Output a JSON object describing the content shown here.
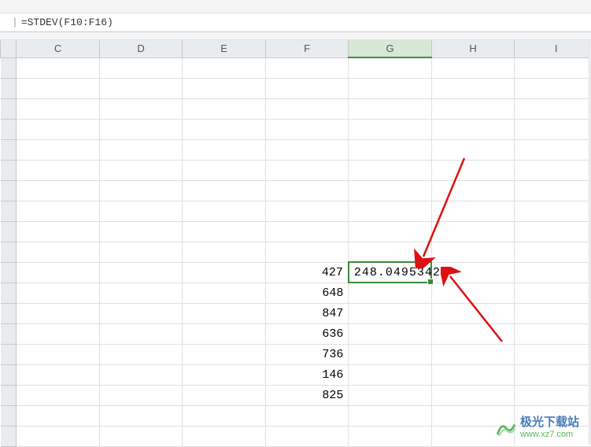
{
  "formula_bar": {
    "formula": "=STDEV(F10:F16)"
  },
  "columns": [
    "C",
    "D",
    "E",
    "F",
    "G",
    "H",
    "I"
  ],
  "active_column": "G",
  "selected_cell": {
    "col": "G",
    "value": "248.0495342"
  },
  "data_column_f": [
    "427",
    "648",
    "847",
    "636",
    "736",
    "146",
    "825"
  ],
  "watermark": {
    "main": "极光下载站",
    "sub": "www.xz7.com"
  },
  "chart_data": {
    "type": "table",
    "title": "Spreadsheet STDEV calculation",
    "columns": [
      "F",
      "G"
    ],
    "rows": [
      {
        "F": 427,
        "G": 248.0495342
      },
      {
        "F": 648,
        "G": null
      },
      {
        "F": 847,
        "G": null
      },
      {
        "F": 636,
        "G": null
      },
      {
        "F": 736,
        "G": null
      },
      {
        "F": 146,
        "G": null
      },
      {
        "F": 825,
        "G": null
      }
    ],
    "formula": "=STDEV(F10:F16)"
  }
}
